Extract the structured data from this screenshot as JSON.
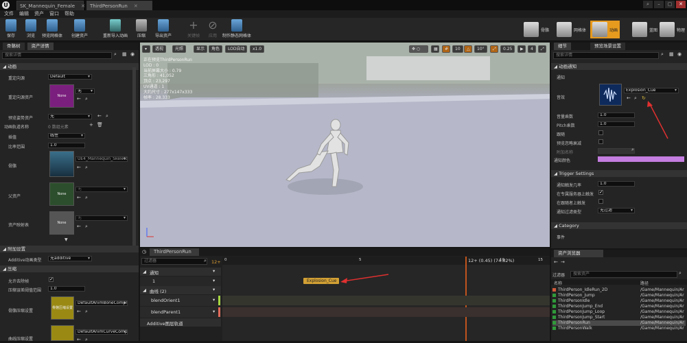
{
  "titlebar": {
    "tabs": [
      "SK_Mannequin_Female",
      "ThirdPersonRun"
    ],
    "window_buttons": [
      "⌕",
      "–",
      "▢",
      "✕"
    ]
  },
  "menu": [
    "文件",
    "编辑",
    "资产",
    "窗口",
    "帮助"
  ],
  "toolbar": {
    "left": [
      "保存",
      "浏览",
      "预览网格体",
      "创建资产",
      "重新导入动画",
      "压缩",
      "导出资产",
      "关键帧",
      "应用",
      "制作静态网格体"
    ],
    "modes": [
      "骨骼",
      "网格体",
      "动画",
      "蓝图",
      "物理"
    ]
  },
  "left_panel": {
    "tabs": [
      "骨骼树",
      "资产详情"
    ],
    "search_placeholder": "搜索详情",
    "section_anim": "动画",
    "props": {
      "retarget_source_label": "重定向源",
      "retarget_source_value": "Default",
      "retarget_src_asset_label": "重定向源资产",
      "retarget_src_asset_value": "无",
      "preview_pose_label": "预览姿势资产",
      "preview_pose_value": "无",
      "anim_track_label": "动画轨道名称",
      "anim_track_value": "0 数组元素",
      "interp_label": "插值",
      "interp_value": "线性",
      "rate_label": "比率范围",
      "rate_value": "1.0",
      "skeleton_label": "骨骼",
      "skeleton_value": "UE4_Mannequin_Skeleton",
      "parent_label": "父资产",
      "parent_value": "无",
      "asset_map_label": "资产映射表",
      "asset_map_value": "无",
      "none_thumb": "None"
    },
    "section_additive": "附加设置",
    "additive_type_label": "Additive动画类型",
    "additive_type_value": "无additive",
    "section_compression": "压缩",
    "allow_strip_label": "允许去除帧",
    "compress_error_label": "压缩误差阈值范围",
    "compress_error_value": "1.0",
    "bone_compress_label": "骨骼压缩设置",
    "bone_compress_value": "DefaultAnimBoneCompre",
    "curve_compress_label": "曲线压缩设置",
    "curve_compress_value": "DefaultAnimCurveCompre",
    "thumb_text": "骨骼压缩设置"
  },
  "viewport": {
    "buttons": [
      "透视",
      "光照",
      "显示",
      "角色",
      "LOD自动",
      "x1.0"
    ],
    "right_values": [
      "10",
      "10°",
      "0.25",
      "4"
    ],
    "stats": [
      "正在预览ThirdPersonRun",
      "LOD : 0",
      "当前屏幕大小 : 0.79",
      "三角形 : 41,052",
      "顶点 : 23,297",
      "UV通道 : 1",
      "大约尺寸 : 277x147x333",
      "帧率 : 28.333"
    ]
  },
  "timeline": {
    "tab": "ThirdPersonRun",
    "search_placeholder": "过滤器",
    "start_frame": "12+",
    "playhead_label": "12+ (0.45) (74.82%)",
    "ticks": [
      "0",
      "5",
      "10",
      "15"
    ],
    "rows": {
      "notifies": "通知",
      "notify_index": "1",
      "curves": "曲线 (2)",
      "curve1": "blendOrient1",
      "curve2": "blendParent1",
      "additive": "Additive图层轨道"
    },
    "notify_event": "Explosion_Cue"
  },
  "right_panel": {
    "tabs": [
      "细节",
      "预览场景设置"
    ],
    "search_placeholder": "搜索详情",
    "section_notify": "动画通知",
    "notify_label": "通知",
    "sound_label": "音效",
    "sound_value": "Explosion_Cue",
    "volume_label": "音量乘数",
    "volume_value": "1.0",
    "pitch_label": "Pitch乘数",
    "pitch_value": "1.0",
    "follow_label": "跟随",
    "preview_ignore_label": "预览忽略衰减",
    "attach_label": "附加名称",
    "attach_value": "",
    "notify_color_label": "通知颜色",
    "section_trigger": "Trigger Settings",
    "trigger_chance_label": "通知触发几率",
    "trigger_chance_value": "1.0",
    "dedicated_label": "在专属服务器上触发",
    "follower_label": "在跟随者上触发",
    "filter_label": "通知过滤类型",
    "filter_value": "无过滤",
    "section_category": "Category",
    "event_label": "事件",
    "colors": {
      "notify_color": "#c47de0"
    }
  },
  "browser": {
    "tab": "资产浏览器",
    "filter": "过滤器",
    "search_placeholder": "搜索资产",
    "col_name": "名称",
    "col_path": "路径",
    "assets": [
      {
        "name": "ThirdPerson_IdleRun_2D",
        "path": "/Game/Mannequin/Ar",
        "color": "#d25a3a"
      },
      {
        "name": "ThirdPerson_Jump",
        "path": "/Game/Mannequin/Ar",
        "color": "#2f9a3a"
      },
      {
        "name": "ThirdPersonIdle",
        "path": "/Game/Mannequin/Ar",
        "color": "#2f9a3a"
      },
      {
        "name": "ThirdPersonJump_End",
        "path": "/Game/Mannequin/Ar",
        "color": "#2f9a3a"
      },
      {
        "name": "ThirdPersonJump_Loop",
        "path": "/Game/Mannequin/Ar",
        "color": "#2f9a3a"
      },
      {
        "name": "ThirdPersonJump_Start",
        "path": "/Game/Mannequin/Ar",
        "color": "#2f9a3a"
      },
      {
        "name": "ThirdPersonRun",
        "path": "/Game/Mannequin/Ar",
        "color": "#2f9a3a"
      },
      {
        "name": "ThirdPersonWalk",
        "path": "/Game/Mannequin/Ar",
        "color": "#2f9a3a"
      }
    ]
  }
}
